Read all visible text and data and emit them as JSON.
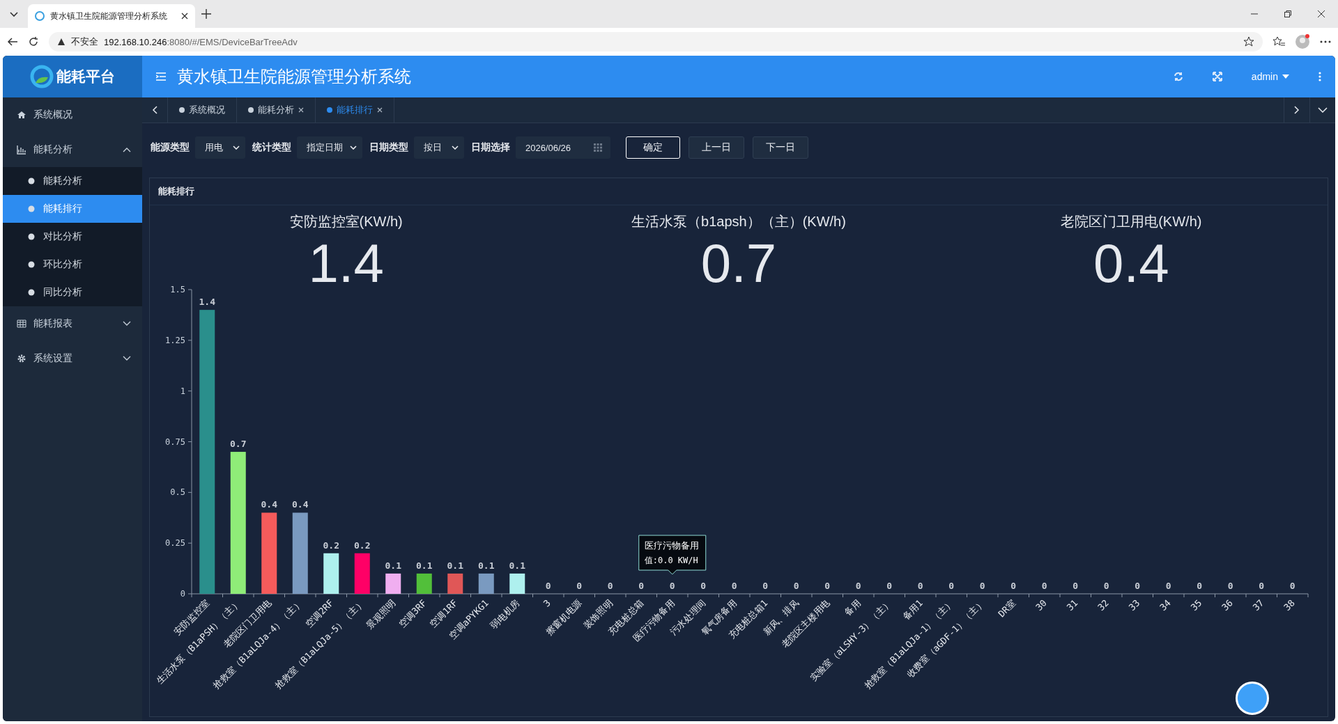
{
  "browser": {
    "tab_title": "黄水镇卫生院能源管理分析系统",
    "security": "不安全",
    "url_host": "192.168.10.246",
    "url_rest": ":8080/#/EMS/DeviceBarTreeAdv"
  },
  "app": {
    "logo": "能耗平台",
    "title": "黄水镇卫生院能源管理分析系统",
    "user": "admin"
  },
  "sidebar": {
    "items": [
      {
        "label": "系统概况"
      },
      {
        "label": "能耗分析",
        "expanded": true,
        "children": [
          {
            "label": "能耗分析",
            "selected": false
          },
          {
            "label": "能耗排行",
            "selected": true
          },
          {
            "label": "对比分析",
            "selected": false
          },
          {
            "label": "环比分析",
            "selected": false
          },
          {
            "label": "同比分析",
            "selected": false
          }
        ]
      },
      {
        "label": "能耗报表",
        "expanded": false
      },
      {
        "label": "系统设置",
        "expanded": false
      }
    ]
  },
  "tabs": [
    {
      "label": "系统概况",
      "selected": false,
      "closable": false
    },
    {
      "label": "能耗分析",
      "selected": false,
      "closable": true
    },
    {
      "label": "能耗排行",
      "selected": true,
      "closable": true
    }
  ],
  "filters": [
    {
      "kind": "select",
      "label": "能源类型",
      "value": "用电"
    },
    {
      "kind": "select",
      "label": "统计类型",
      "value": "指定日期"
    },
    {
      "kind": "select",
      "label": "日期类型",
      "value": "按日"
    },
    {
      "kind": "date",
      "label": "日期选择",
      "value": "2026/06/26"
    }
  ],
  "buttons": [
    {
      "label": "确定",
      "primary": true
    },
    {
      "label": "上一日",
      "primary": false
    },
    {
      "label": "下一日",
      "primary": false
    }
  ],
  "panel": {
    "title": "能耗排行",
    "stats": [
      {
        "title": "安防监控室(KW/h)",
        "value": "1.4"
      },
      {
        "title": "生活水泵（b1apsh）（主）(KW/h)",
        "value": "0.7"
      },
      {
        "title": "老院区门卫用电(KW/h)",
        "value": "0.4"
      }
    ],
    "chart_data": {
      "type": "bar",
      "ylim": [
        0,
        1.5
      ],
      "yticks": [
        0,
        0.25,
        0.5,
        0.75,
        1,
        1.25,
        1.5
      ],
      "data_labels": true,
      "categories": [
        "安防监控室",
        "生活水泵（B1aPSH）（主）",
        "老院区门卫用电",
        "抢救室（B1aLQJa-4）（主）",
        "空调2RF",
        "抢救室（B1aLQJa-5）（主）",
        "景观照明",
        "空调3RF",
        "空调1RF",
        "空调aPYKG1",
        "弱电机房",
        "3",
        "擦窗机电源",
        "装饰照明",
        "充电桩总箱",
        "医疗污物备用",
        "污水处理间",
        "氧气房备用",
        "充电桩总箱1",
        "新风、排风",
        "老院区主楼用电",
        "备用",
        "实验室（aLSHY-3）（主）",
        "备用1",
        "抢救室（B1aLQJa-1）（主）",
        "收费室（aGDF-1）（主）",
        "DR室",
        "30",
        "31",
        "32",
        "33",
        "34",
        "35",
        "36",
        "37",
        "38"
      ],
      "values": [
        1.4,
        0.7,
        0.4,
        0.4,
        0.2,
        0.2,
        0.1,
        0.1,
        0.1,
        0.1,
        0.1,
        0,
        0,
        0,
        0,
        0,
        0,
        0,
        0,
        0,
        0,
        0,
        0,
        0,
        0,
        0,
        0,
        0,
        0,
        0,
        0,
        0,
        0,
        0,
        0,
        0
      ],
      "colors": [
        "#2a8f8c",
        "#8fec78",
        "#f55b5b",
        "#7a9ac0",
        "#aef0ee",
        "#ff0066",
        "#f0aef0",
        "#52bf3a",
        "#e05757",
        "#7a9ac0",
        "#aef0ee",
        null,
        null,
        null,
        null,
        null,
        null,
        null,
        null,
        null,
        null,
        null,
        null,
        null,
        null,
        null,
        null,
        null,
        null,
        null,
        null,
        null,
        null,
        null,
        null,
        null
      ]
    },
    "tooltip": {
      "title": "医疗污物备用",
      "text": "值:0.0 KW/H"
    }
  }
}
